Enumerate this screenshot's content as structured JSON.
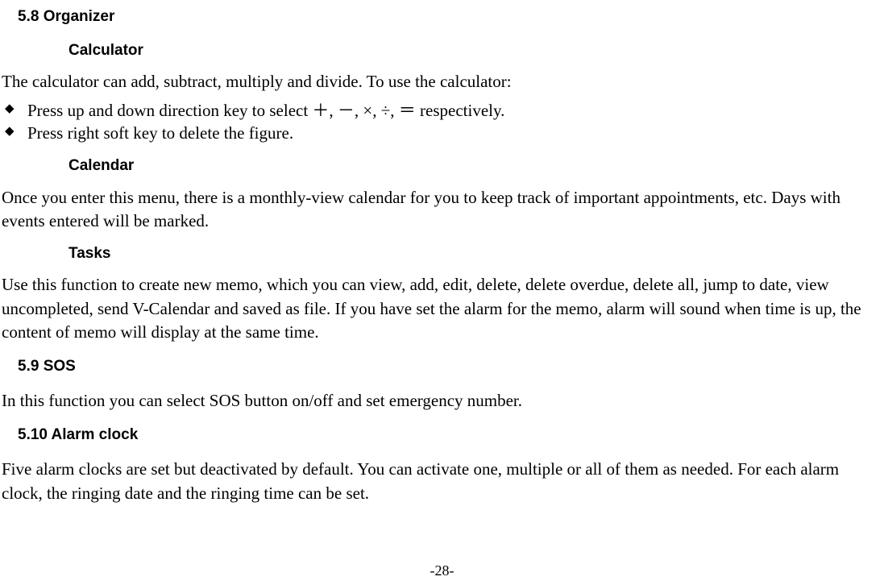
{
  "sections": {
    "organizer": {
      "heading": "5.8 Organizer",
      "calculator": {
        "heading": "Calculator",
        "intro": "The calculator can add, subtract, multiply and divide. To use the calculator:",
        "bullets": [
          "Press up and down direction key to select ＋, －, ×, ÷, ＝ respectively.",
          "Press right soft key to delete the figure."
        ]
      },
      "calendar": {
        "heading": "Calendar",
        "body": "Once you enter this menu, there is a monthly-view calendar for you to keep track of important appointments, etc. Days with events entered will be marked."
      },
      "tasks": {
        "heading": "Tasks",
        "body": "Use this function to create new memo, which you can view, add, edit, delete, delete overdue, delete all, jump to date, view uncompleted, send V-Calendar and saved as file. If you have set the alarm for the memo, alarm will sound when time is up, the content of memo will display at the same time."
      }
    },
    "sos": {
      "heading": "5.9 SOS",
      "body": "In this function you can select SOS button on/off and set emergency number."
    },
    "alarm": {
      "heading": "5.10 Alarm clock",
      "body": "Five alarm clocks are set but deactivated by default. You can activate one, multiple or all of them as needed. For each alarm clock, the ringing date and the ringing time can be set."
    }
  },
  "page_number": "-28-"
}
